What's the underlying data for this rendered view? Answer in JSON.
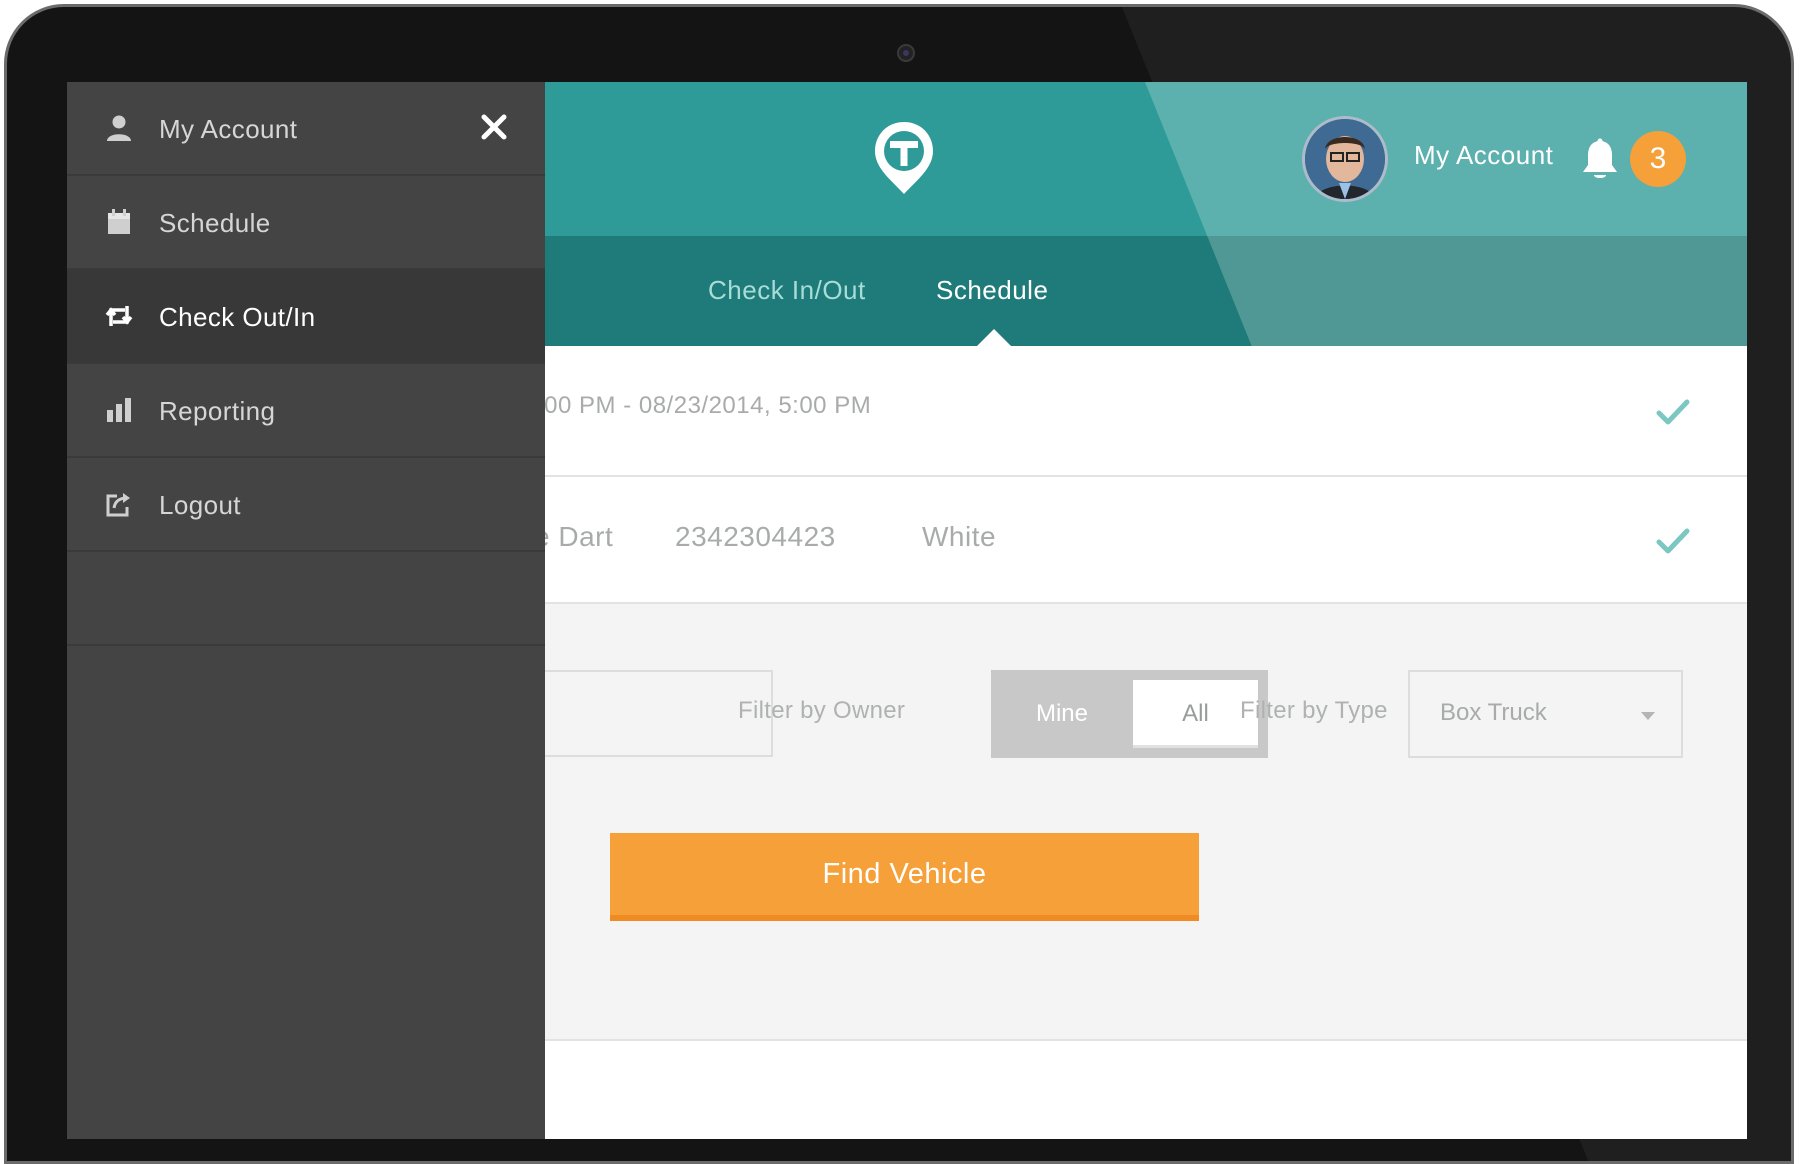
{
  "colors": {
    "header_teal": "#2f9b98",
    "nav_teal": "#1f7b79",
    "accent_orange": "#f6a03a",
    "drawer_bg": "#444444",
    "drawer_active_bg": "#383838",
    "check_green": "#7cc7c1"
  },
  "drawer": {
    "close_icon": "close-icon",
    "items": [
      {
        "label": "My Account",
        "icon": "user-icon",
        "active": false
      },
      {
        "label": "Schedule",
        "icon": "calendar-icon",
        "active": false
      },
      {
        "label": "Check Out/In",
        "icon": "swap-icon",
        "active": true
      },
      {
        "label": "Reporting",
        "icon": "bar-chart-icon",
        "active": false
      },
      {
        "label": "Logout",
        "icon": "logout-icon",
        "active": false
      }
    ]
  },
  "header": {
    "logo_icon": "map-pin-t-icon",
    "account_label": "My Account",
    "notification_icon": "bell-icon",
    "notification_count": "3"
  },
  "nav": {
    "tabs": [
      {
        "label": "Check In/Out",
        "active": false
      },
      {
        "label": "Schedule",
        "active": true
      }
    ]
  },
  "summary": {
    "date_range": ":00 PM - 08/23/2014, 5:00 PM",
    "vehicle_model": "e Dart",
    "vehicle_number": "2342304423",
    "vehicle_color": "White"
  },
  "filters": {
    "owner_label": "Filter by Owner",
    "owner_options": [
      "Mine",
      "All"
    ],
    "owner_selected": "All",
    "type_label": "Filter by Type",
    "type_value": "Box Truck"
  },
  "actions": {
    "find_label": "Find Vehicle"
  }
}
